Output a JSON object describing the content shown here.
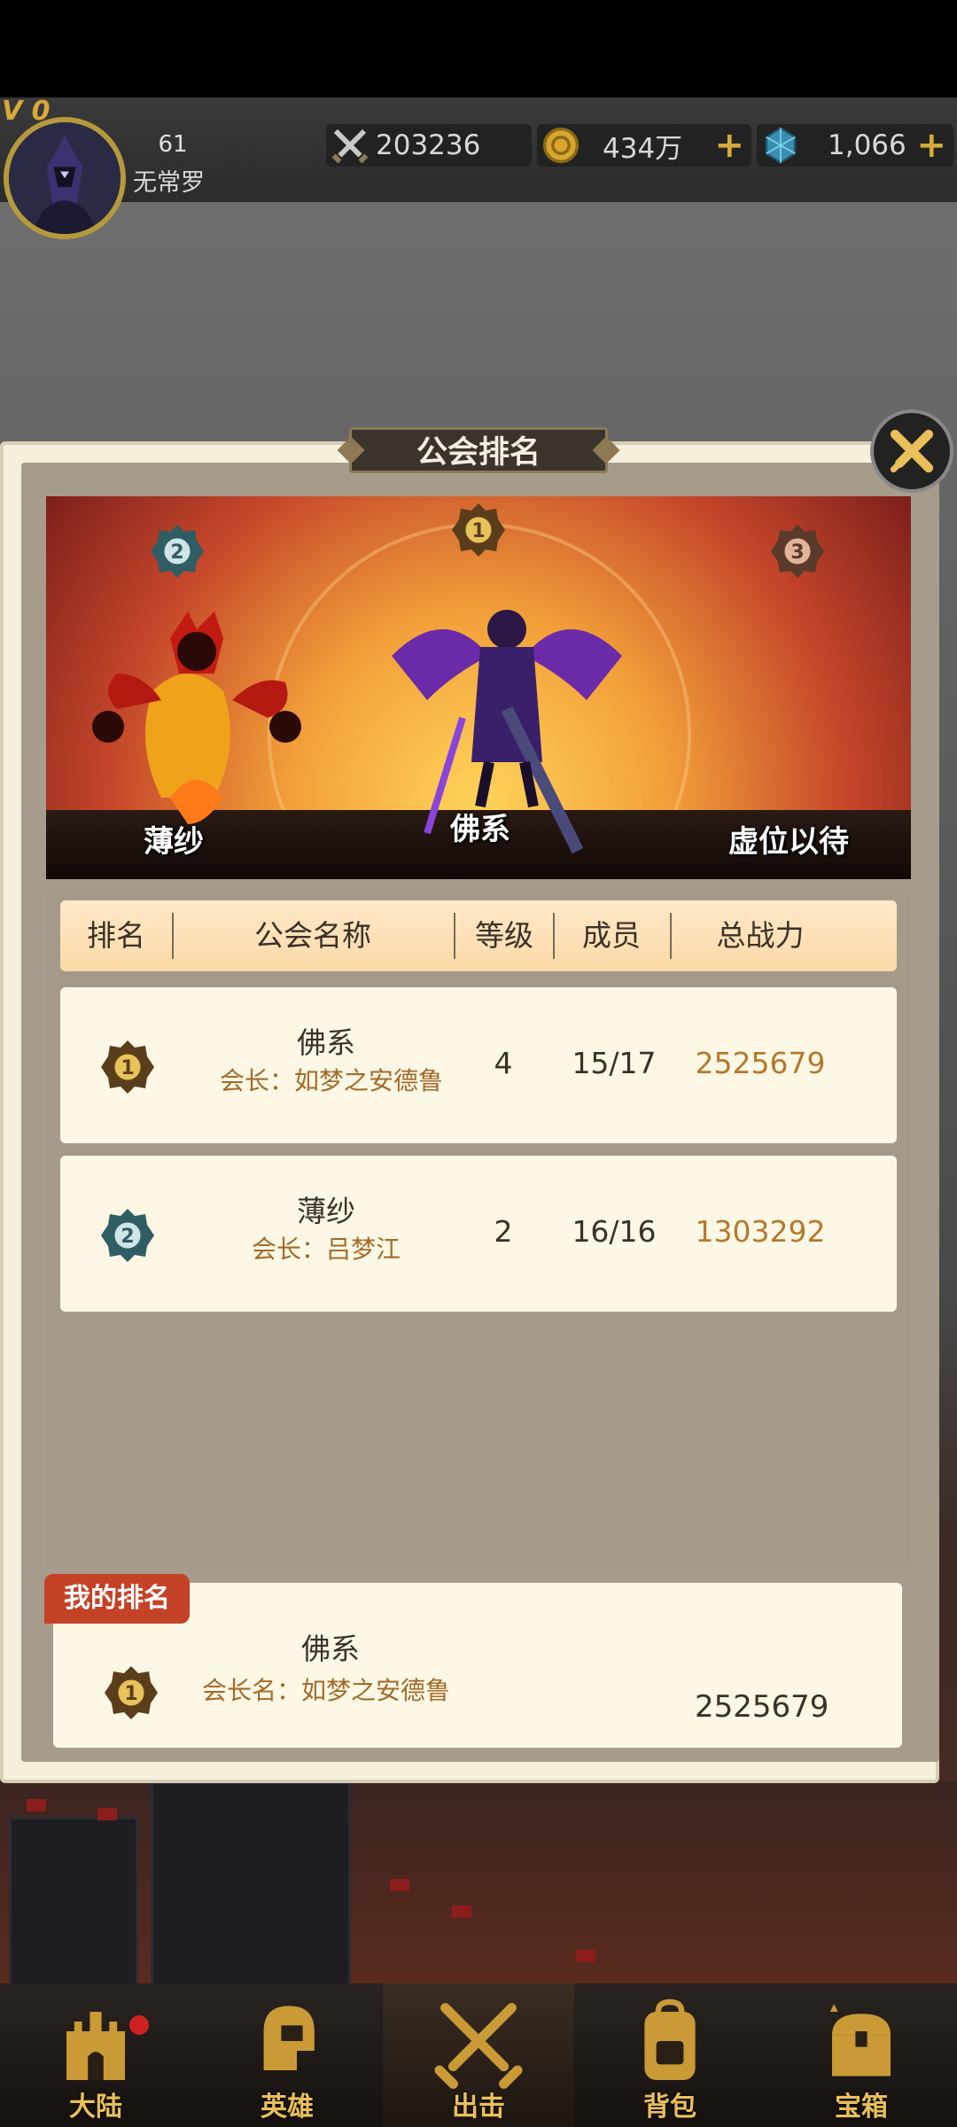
{
  "player": {
    "vip": "V 0",
    "level": "61",
    "name": "无常罗"
  },
  "stats": {
    "power": "203236",
    "gold": "434万",
    "gems": "1,066"
  },
  "panel": {
    "title": "公会排名"
  },
  "podium": {
    "first_name": "佛系",
    "second_name": "薄纱",
    "third_name": "虚位以待"
  },
  "table": {
    "headers": [
      "排名",
      "公会名称",
      "等级",
      "成员",
      "总战力"
    ],
    "rows": [
      {
        "rank": 1,
        "name": "佛系",
        "leader": "会长：如梦之安德鲁",
        "level": "4",
        "members": "15/17",
        "power": "2525679"
      },
      {
        "rank": 2,
        "name": "薄纱",
        "leader": "会长：吕梦江",
        "level": "2",
        "members": "16/16",
        "power": "1303292"
      }
    ]
  },
  "my_rank": {
    "tag": "我的排名",
    "rank": 1,
    "name": "佛系",
    "leader": "会长名：如梦之安德鲁",
    "power": "2525679"
  },
  "nav": [
    {
      "label": "大陆",
      "icon": "castle-icon",
      "badge": true
    },
    {
      "label": "英雄",
      "icon": "helmet-icon",
      "badge": false
    },
    {
      "label": "出击",
      "icon": "crossed-swords-icon",
      "badge": false
    },
    {
      "label": "背包",
      "icon": "backpack-icon",
      "badge": false
    },
    {
      "label": "宝箱",
      "icon": "treasure-chest-icon",
      "badge": false
    }
  ],
  "colors": {
    "accent_gold": "#e9c05a",
    "power_text": "#b5792d",
    "leader_text": "#a36a2a",
    "tag_red": "#c44227"
  }
}
